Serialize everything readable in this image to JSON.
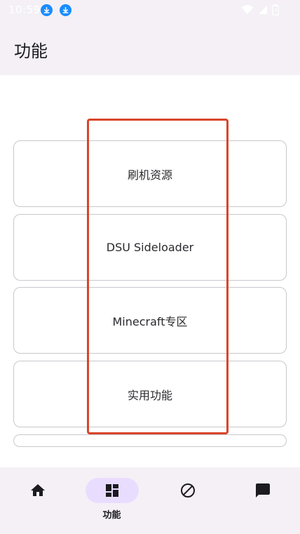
{
  "status": {
    "time": "10:59",
    "icons": [
      "download-icon",
      "download-icon",
      "wifi-icon",
      "signal-icon",
      "battery-icon"
    ]
  },
  "app_bar": {
    "title": "功能"
  },
  "cards": [
    {
      "label": "刷机资源"
    },
    {
      "label": "DSU Sideloader"
    },
    {
      "label": "Minecraft专区"
    },
    {
      "label": "实用功能"
    }
  ],
  "bottom_nav": {
    "items": [
      {
        "icon": "home-icon",
        "label": ""
      },
      {
        "icon": "dashboard-icon",
        "label": "功能",
        "active": true
      },
      {
        "icon": "block-icon",
        "label": ""
      },
      {
        "icon": "chat-icon",
        "label": ""
      }
    ]
  },
  "colors": {
    "accent_highlight": "#d9452b",
    "active_pill": "#e9ddff",
    "surface": "#f4f0f6",
    "download_badge": "#1a8cff"
  }
}
